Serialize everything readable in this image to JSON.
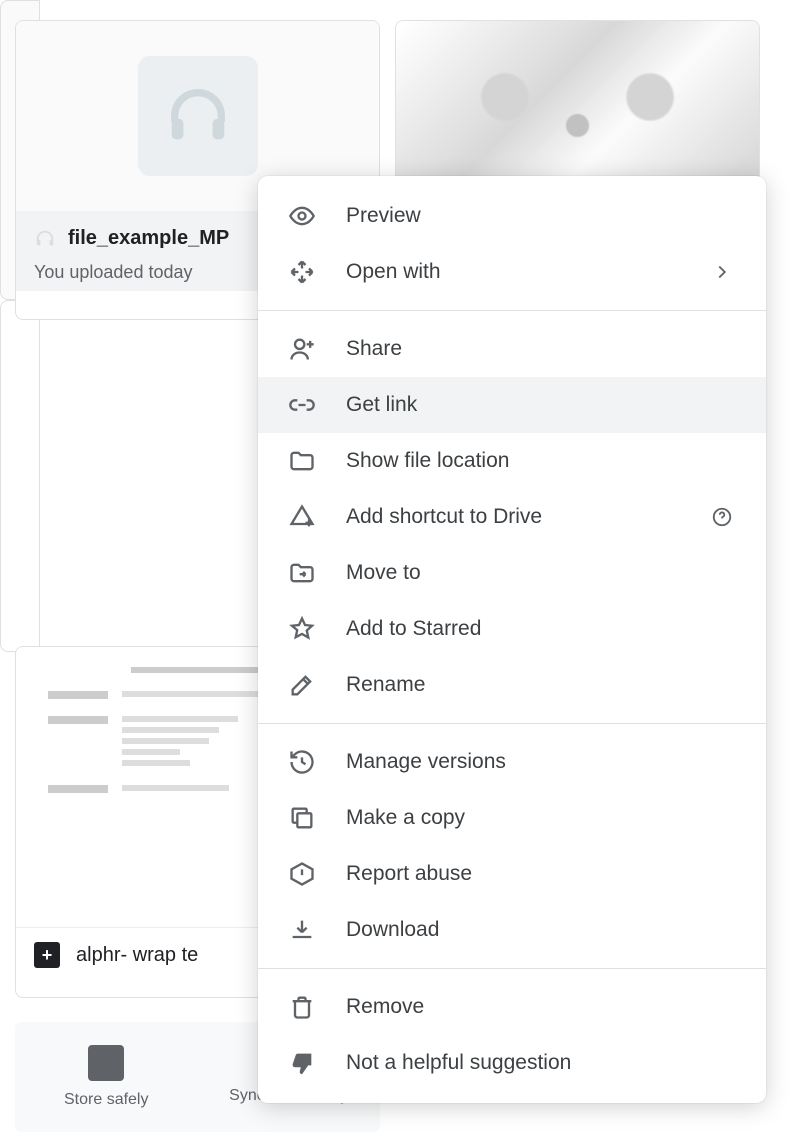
{
  "cards": {
    "audio": {
      "filename": "file_example_MP",
      "subtitle": "You uploaded today"
    },
    "doc": {
      "filename": "alphr- wrap te"
    }
  },
  "promo": {
    "col1": "Store safely",
    "col2": "Sync seamlessly"
  },
  "menu": {
    "groups": [
      [
        {
          "key": "preview",
          "label": "Preview",
          "icon": "eye"
        },
        {
          "key": "open-with",
          "label": "Open with",
          "icon": "open-with",
          "trail": "chevron"
        }
      ],
      [
        {
          "key": "share",
          "label": "Share",
          "icon": "person-add"
        },
        {
          "key": "get-link",
          "label": "Get link",
          "icon": "link",
          "hovered": true
        },
        {
          "key": "show-location",
          "label": "Show file location",
          "icon": "folder"
        },
        {
          "key": "add-shortcut",
          "label": "Add shortcut to Drive",
          "icon": "drive-add",
          "trail": "help"
        },
        {
          "key": "move-to",
          "label": "Move to",
          "icon": "folder-move"
        },
        {
          "key": "add-starred",
          "label": "Add to Starred",
          "icon": "star"
        },
        {
          "key": "rename",
          "label": "Rename",
          "icon": "pencil"
        }
      ],
      [
        {
          "key": "manage-versions",
          "label": "Manage versions",
          "icon": "history"
        },
        {
          "key": "make-copy",
          "label": "Make a copy",
          "icon": "copy"
        },
        {
          "key": "report-abuse",
          "label": "Report abuse",
          "icon": "report"
        },
        {
          "key": "download",
          "label": "Download",
          "icon": "download"
        }
      ],
      [
        {
          "key": "remove",
          "label": "Remove",
          "icon": "trash"
        },
        {
          "key": "not-helpful",
          "label": "Not a helpful suggestion",
          "icon": "thumb-down"
        }
      ]
    ]
  }
}
